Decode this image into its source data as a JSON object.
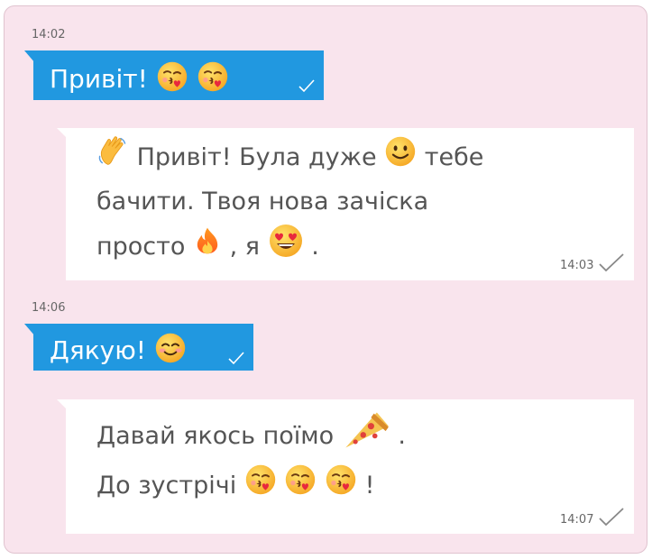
{
  "messages": [
    {
      "time": "14:02",
      "text": "Привіт!"
    },
    {
      "text_a": "Привіт! Була дуже",
      "text_b": "тебе",
      "line2": "бачити. Твоя нова зачіска",
      "line3_a": "просто",
      "line3_b": ", я",
      "line3_c": ".",
      "time": "14:03"
    },
    {
      "time": "14:06",
      "text": "Дякую!"
    },
    {
      "line1_a": "Давай якось поїмо",
      "line1_b": ".",
      "line2_a": "До зустрічі",
      "line2_b": "!",
      "time": "14:07"
    }
  ],
  "icons": {
    "kiss": "kissing-face-with-heart-icon",
    "wave": "waving-hand-icon",
    "smile": "slightly-smiling-face-icon",
    "fire": "fire-icon",
    "heart_eyes": "heart-eyes-face-icon",
    "blush": "smiling-face-with-blush-icon",
    "pizza": "pizza-slice-icon",
    "check": "checkmark-icon"
  },
  "colors": {
    "chat_background": "#f9e4ed",
    "outgoing_bubble": "#2198e0",
    "incoming_bubble": "#ffffff",
    "incoming_text": "#555555"
  }
}
